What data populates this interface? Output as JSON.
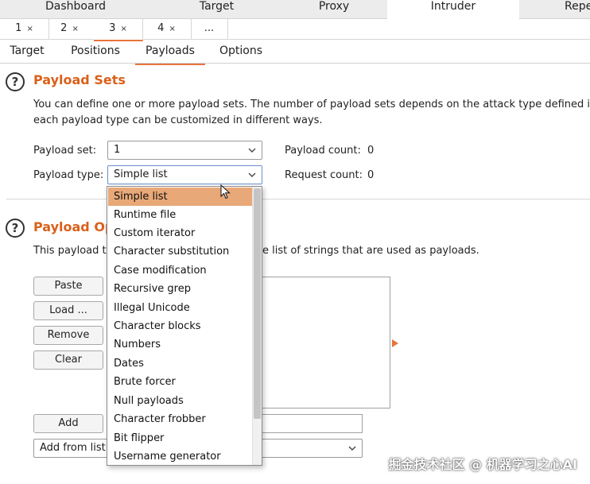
{
  "top_tabs": [
    "Dashboard",
    "Target",
    "Proxy",
    "Intruder",
    "Repe"
  ],
  "active_top_tab": "Intruder",
  "attack_tabs": [
    {
      "label": "1",
      "close": "×"
    },
    {
      "label": "2",
      "close": "×"
    },
    {
      "label": "3",
      "close": "×"
    },
    {
      "label": "4",
      "close": "×"
    },
    {
      "label": "...",
      "close": ""
    }
  ],
  "intruder_tabs": [
    "Target",
    "Positions",
    "Payloads",
    "Options"
  ],
  "active_intruder_tab": "Payloads",
  "payload_sets": {
    "help": "?",
    "title": "Payload Sets",
    "desc_line1": "You can define one or more payload sets. The number of payload sets depends on the attack type defined in",
    "desc_line2": "each payload type can be customized in different ways.",
    "set_label": "Payload set:",
    "set_value": "1",
    "type_label": "Payload type:",
    "type_value": "Simple list",
    "count_label": "Payload count:",
    "count_value": "0",
    "request_label": "Request count:",
    "request_value": "0"
  },
  "payload_options": {
    "help": "?",
    "title": "Payload Opt",
    "desc_left": "This payload ty",
    "desc_right": "e list of strings that are used as payloads.",
    "buttons": [
      "Paste",
      "Load ...",
      "Remove",
      "Clear"
    ],
    "add_label": "Add",
    "add_from_list_label": "Add from list"
  },
  "dropdown_items": [
    "Simple list",
    "Runtime file",
    "Custom iterator",
    "Character substitution",
    "Case modification",
    "Recursive grep",
    "Illegal Unicode",
    "Character blocks",
    "Numbers",
    "Dates",
    "Brute forcer",
    "Null payloads",
    "Character frobber",
    "Bit flipper",
    "Username generator"
  ],
  "dropdown_selected": "Simple list",
  "watermark": "掘金技术社区 @ 机器学习之心AI",
  "colors": {
    "accent": "#e8743b",
    "title": "#d9611a",
    "selected_item": "#e8a878"
  }
}
